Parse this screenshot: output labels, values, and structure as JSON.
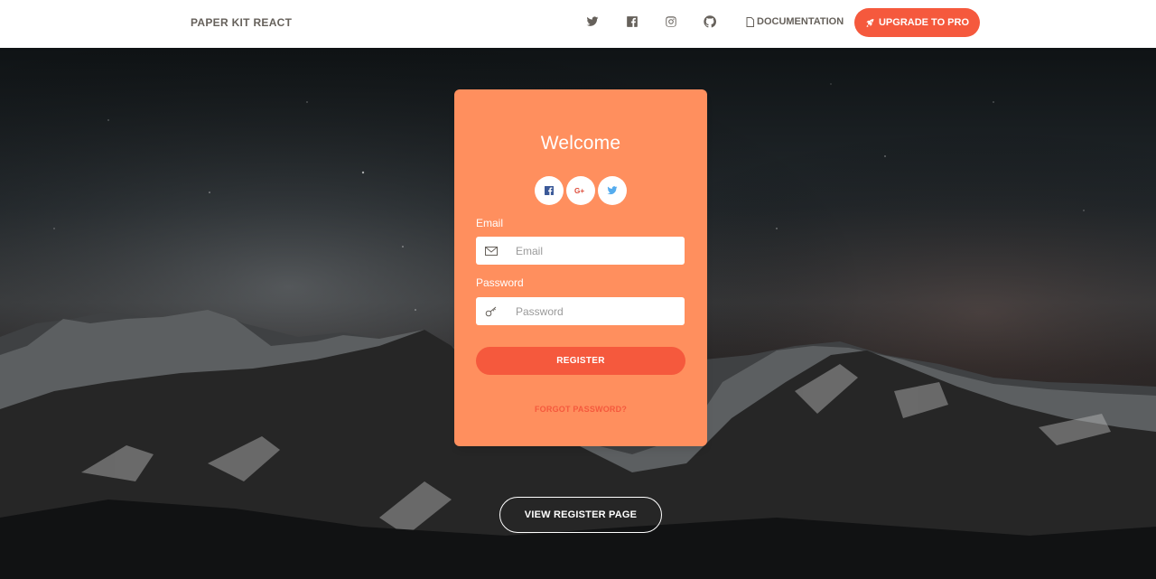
{
  "navbar": {
    "brand": "PAPER KIT REACT",
    "icons": [
      "twitter-icon",
      "facebook-icon",
      "instagram-icon",
      "github-icon"
    ],
    "documentation": "DOCUMENTATION",
    "upgrade": "UPGRADE TO PRO"
  },
  "card": {
    "title": "Welcome",
    "social": [
      "facebook-icon",
      "google-plus-icon",
      "twitter-icon"
    ],
    "email_label": "Email",
    "email_placeholder": "Email",
    "email_icon": "envelope-icon",
    "password_label": "Password",
    "password_placeholder": "Password",
    "password_icon": "key-icon",
    "register": "REGISTER",
    "forgot": "FORGOT PASSWORD?"
  },
  "view_register": "VIEW REGISTER PAGE",
  "colors": {
    "accent": "#f5593d",
    "card": "#ff8f5e",
    "nav_text": "#66615b"
  }
}
